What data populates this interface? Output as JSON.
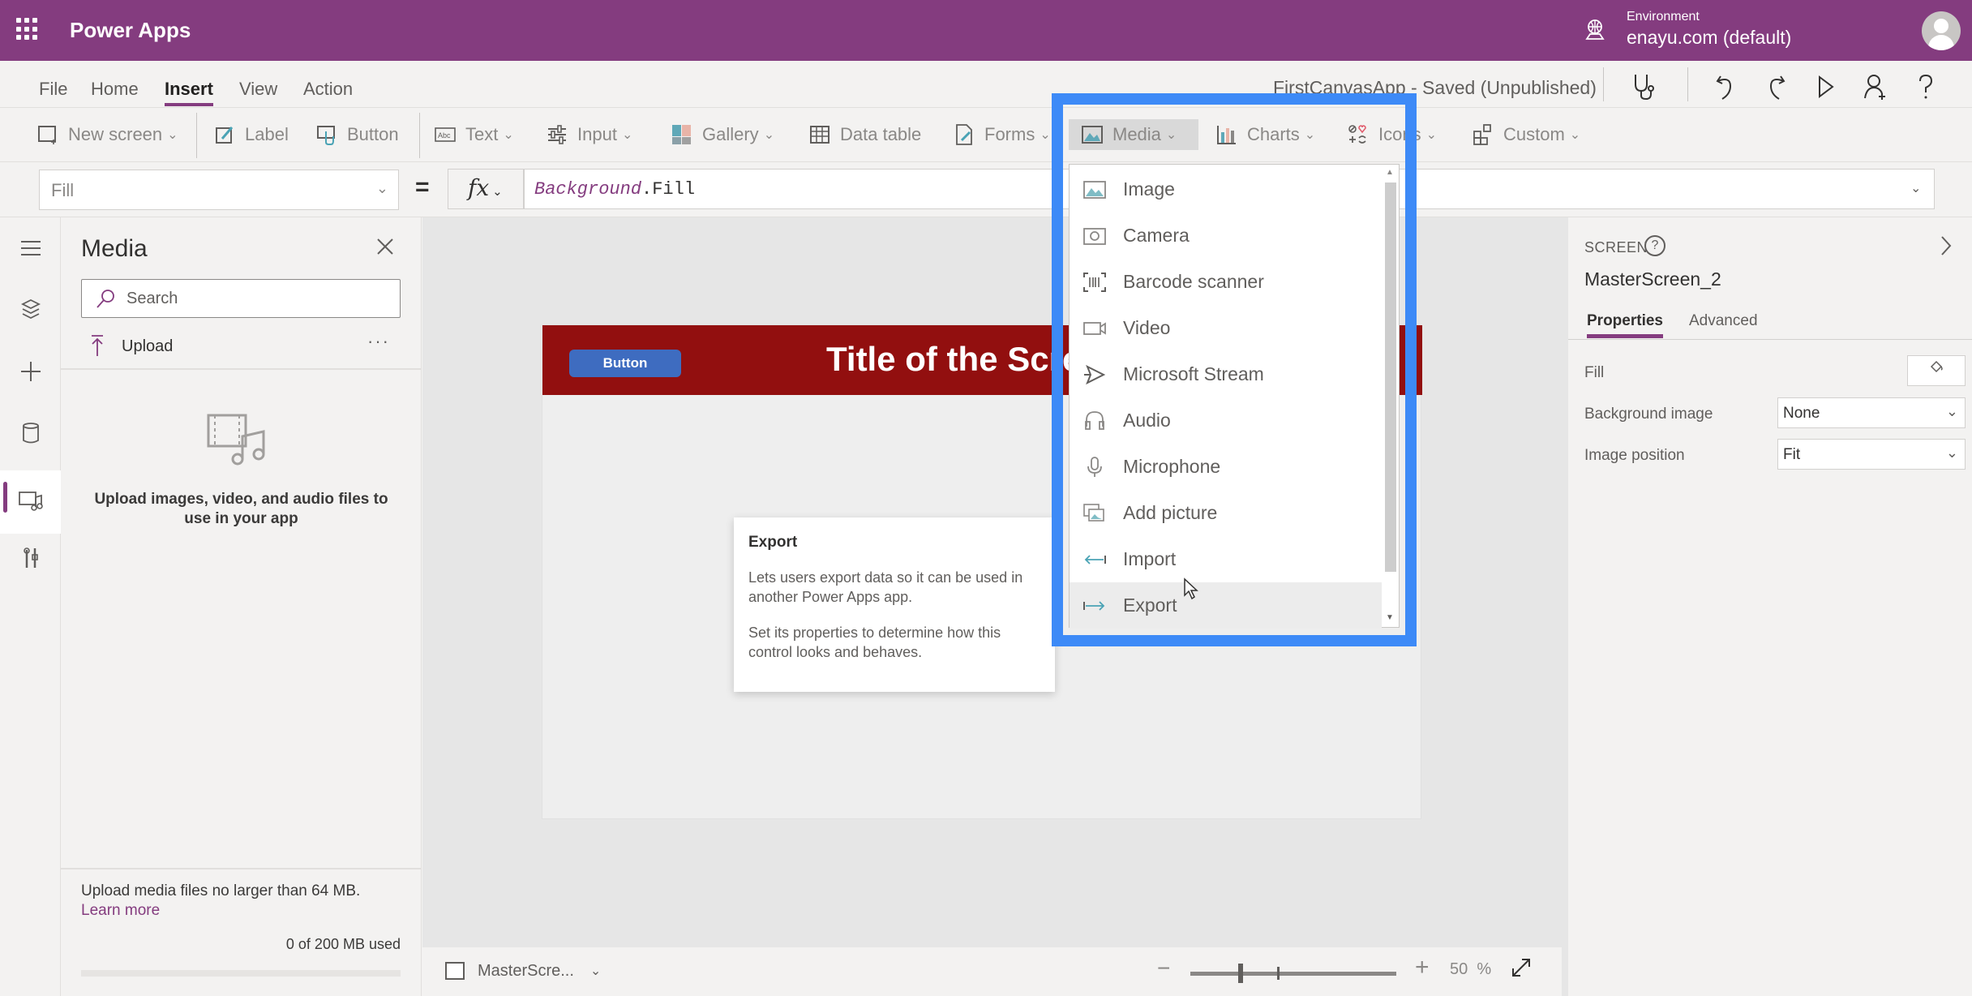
{
  "topbar": {
    "app_name": "Power Apps",
    "environment_label": "Environment",
    "environment_value": "enayu.com (default)"
  },
  "menu": {
    "items": [
      {
        "label": "File"
      },
      {
        "label": "Home"
      },
      {
        "label": "Insert",
        "active": true
      },
      {
        "label": "View"
      },
      {
        "label": "Action"
      }
    ],
    "app_status": "FirstCanvasApp - Saved (Unpublished)"
  },
  "toolbar": {
    "items": [
      {
        "label": "New screen",
        "icon": "new-screen-icon",
        "dropdown": true
      },
      {
        "label": "Label",
        "icon": "label-icon"
      },
      {
        "label": "Button",
        "icon": "button-icon"
      },
      {
        "label": "Text",
        "icon": "text-icon",
        "dropdown": true
      },
      {
        "label": "Input",
        "icon": "input-icon",
        "dropdown": true
      },
      {
        "label": "Gallery",
        "icon": "gallery-icon",
        "dropdown": true
      },
      {
        "label": "Data table",
        "icon": "data-table-icon"
      },
      {
        "label": "Forms",
        "icon": "forms-icon",
        "dropdown": true
      },
      {
        "label": "Media",
        "icon": "media-icon",
        "dropdown": true,
        "active": true
      },
      {
        "label": "Charts",
        "icon": "charts-icon",
        "dropdown": true
      },
      {
        "label": "Icons",
        "icon": "icons-icon",
        "dropdown": true
      },
      {
        "label": "Custom",
        "icon": "custom-icon",
        "dropdown": true
      }
    ]
  },
  "formula": {
    "property": "Fill",
    "equals": "=",
    "fx": "fx",
    "expression_keyword": "Background",
    "expression_rest": ".Fill"
  },
  "media_panel": {
    "title": "Media",
    "search_placeholder": "Search",
    "upload_label": "Upload",
    "more": "···",
    "empty_text": "Upload images, video, and audio files to use in your app",
    "footer_note": "Upload media files no larger than 64 MB.",
    "footer_link": "Learn more",
    "usage_text": "0 of 200 MB used",
    "usage_fraction": 0
  },
  "canvas": {
    "button_label": "Button",
    "title_text": "Title of the Screen",
    "header_color": "#920f0f",
    "button_color": "#3e6cc0"
  },
  "tooltip": {
    "title": "Export",
    "paragraphs": [
      "Lets users export data so it can be used in another Power Apps app.",
      "Set its properties to determine how this control looks and behaves."
    ]
  },
  "media_dropdown": {
    "items": [
      {
        "label": "Image",
        "icon": "image-icon"
      },
      {
        "label": "Camera",
        "icon": "camera-icon"
      },
      {
        "label": "Barcode scanner",
        "icon": "barcode-icon"
      },
      {
        "label": "Video",
        "icon": "video-icon"
      },
      {
        "label": "Microsoft Stream",
        "icon": "stream-icon"
      },
      {
        "label": "Audio",
        "icon": "audio-icon"
      },
      {
        "label": "Microphone",
        "icon": "microphone-icon"
      },
      {
        "label": "Add picture",
        "icon": "add-picture-icon"
      },
      {
        "label": "Import",
        "icon": "import-icon"
      },
      {
        "label": "Export",
        "icon": "export-icon",
        "hovered": true
      }
    ],
    "highlight_color": "#3d8af7"
  },
  "statusbar": {
    "screen_name": "MasterScre...",
    "zoom_minus": "−",
    "zoom_plus": "+",
    "zoom_value": "50",
    "zoom_unit": "%",
    "zoom_percent": 50
  },
  "right_panel": {
    "type_label": "SCREEN",
    "screen_name": "MasterScreen_2",
    "tabs": [
      {
        "label": "Properties",
        "active": true
      },
      {
        "label": "Advanced"
      }
    ],
    "properties": [
      {
        "label": "Fill"
      },
      {
        "label": "Background image",
        "value": "None"
      },
      {
        "label": "Image position",
        "value": "Fit"
      }
    ]
  },
  "colors": {
    "brand": "#843c7f",
    "highlight": "#3d8af7"
  }
}
